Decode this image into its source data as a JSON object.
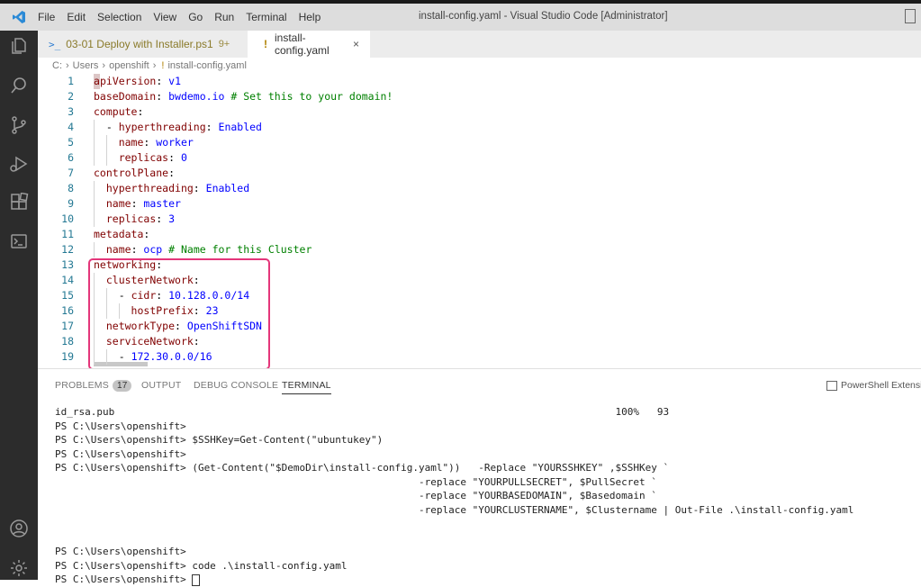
{
  "titlebar": {
    "menu": [
      "File",
      "Edit",
      "Selection",
      "View",
      "Go",
      "Run",
      "Terminal",
      "Help"
    ],
    "window_title": "install-config.yaml - Visual Studio Code [Administrator]"
  },
  "tabs": [
    {
      "label": "03-01 Deploy with Installer.ps1",
      "badge": "9+",
      "icon": ">_"
    },
    {
      "label": "install-config.yaml",
      "icon": "!",
      "close": "×"
    }
  ],
  "breadcrumb": {
    "parts": [
      "C:",
      "Users",
      "openshift",
      "install-config.yaml"
    ]
  },
  "editor": {
    "lines": [
      {
        "n": "1",
        "indent": 0,
        "parts": [
          [
            "k",
            "apiVersion"
          ],
          [
            "p",
            ": "
          ],
          [
            "v",
            "v1"
          ]
        ]
      },
      {
        "n": "2",
        "indent": 0,
        "parts": [
          [
            "k",
            "baseDomain"
          ],
          [
            "p",
            ": "
          ],
          [
            "v",
            "bwdemo.io"
          ],
          [
            "c",
            " # Set this to your domain!"
          ]
        ]
      },
      {
        "n": "3",
        "indent": 0,
        "parts": [
          [
            "k",
            "compute"
          ],
          [
            "p",
            ":"
          ]
        ]
      },
      {
        "n": "4",
        "indent": 1,
        "parts": [
          [
            "p",
            "- "
          ],
          [
            "k",
            "hyperthreading"
          ],
          [
            "p",
            ": "
          ],
          [
            "v",
            "Enabled"
          ]
        ]
      },
      {
        "n": "5",
        "indent": 2,
        "parts": [
          [
            "k",
            "name"
          ],
          [
            "p",
            ": "
          ],
          [
            "v",
            "worker"
          ]
        ]
      },
      {
        "n": "6",
        "indent": 2,
        "parts": [
          [
            "k",
            "replicas"
          ],
          [
            "p",
            ": "
          ],
          [
            "v",
            "0"
          ]
        ]
      },
      {
        "n": "7",
        "indent": 0,
        "parts": [
          [
            "k",
            "controlPlane"
          ],
          [
            "p",
            ":"
          ]
        ]
      },
      {
        "n": "8",
        "indent": 1,
        "parts": [
          [
            "k",
            "hyperthreading"
          ],
          [
            "p",
            ": "
          ],
          [
            "v",
            "Enabled"
          ]
        ]
      },
      {
        "n": "9",
        "indent": 1,
        "parts": [
          [
            "k",
            "name"
          ],
          [
            "p",
            ": "
          ],
          [
            "v",
            "master"
          ]
        ]
      },
      {
        "n": "10",
        "indent": 1,
        "parts": [
          [
            "k",
            "replicas"
          ],
          [
            "p",
            ": "
          ],
          [
            "v",
            "3"
          ]
        ]
      },
      {
        "n": "11",
        "indent": 0,
        "parts": [
          [
            "k",
            "metadata"
          ],
          [
            "p",
            ":"
          ]
        ]
      },
      {
        "n": "12",
        "indent": 1,
        "parts": [
          [
            "k",
            "name"
          ],
          [
            "p",
            ": "
          ],
          [
            "v",
            "ocp"
          ],
          [
            "c",
            " # Name for this Cluster"
          ]
        ]
      },
      {
        "n": "13",
        "indent": 0,
        "parts": [
          [
            "k",
            "networking"
          ],
          [
            "p",
            ":"
          ]
        ]
      },
      {
        "n": "14",
        "indent": 1,
        "parts": [
          [
            "k",
            "clusterNetwork"
          ],
          [
            "p",
            ":"
          ]
        ]
      },
      {
        "n": "15",
        "indent": 2,
        "parts": [
          [
            "p",
            "- "
          ],
          [
            "k",
            "cidr"
          ],
          [
            "p",
            ": "
          ],
          [
            "v",
            "10.128.0.0/14"
          ]
        ]
      },
      {
        "n": "16",
        "indent": 3,
        "parts": [
          [
            "k",
            "hostPrefix"
          ],
          [
            "p",
            ": "
          ],
          [
            "v",
            "23"
          ]
        ]
      },
      {
        "n": "17",
        "indent": 1,
        "parts": [
          [
            "k",
            "networkType"
          ],
          [
            "p",
            ": "
          ],
          [
            "v",
            "OpenShiftSDN"
          ]
        ]
      },
      {
        "n": "18",
        "indent": 1,
        "parts": [
          [
            "k",
            "serviceNetwork"
          ],
          [
            "p",
            ":"
          ]
        ]
      },
      {
        "n": "19",
        "indent": 2,
        "parts": [
          [
            "p",
            "- "
          ],
          [
            "v",
            "172.30.0.0/16"
          ]
        ]
      }
    ]
  },
  "panel": {
    "problems_label": "PROBLEMS",
    "problems_count": "17",
    "output_label": "OUTPUT",
    "debug_label": "DEBUG CONSOLE",
    "terminal_label": "TERMINAL",
    "shell_label": "PowerShell Extension"
  },
  "terminal": {
    "lines": [
      "id_rsa.pub                                                                                    100%   93",
      "PS C:\\Users\\openshift>",
      "PS C:\\Users\\openshift> $SSHKey=Get-Content(\"ubuntukey\")",
      "PS C:\\Users\\openshift>",
      "PS C:\\Users\\openshift> (Get-Content(\"$DemoDir\\install-config.yaml\"))   -Replace \"YOURSSHKEY\" ,$SSHKey `",
      "                                                             -replace \"YOURPULLSECRET\", $PullSecret `",
      "                                                             -replace \"YOURBASEDOMAIN\", $Basedomain `",
      "                                                             -replace \"YOURCLUSTERNAME\", $Clustername | Out-File .\\install-config.yaml",
      "",
      "",
      "PS C:\\Users\\openshift>",
      "PS C:\\Users\\openshift> code .\\install-config.yaml",
      "PS C:\\Users\\openshift> "
    ]
  }
}
